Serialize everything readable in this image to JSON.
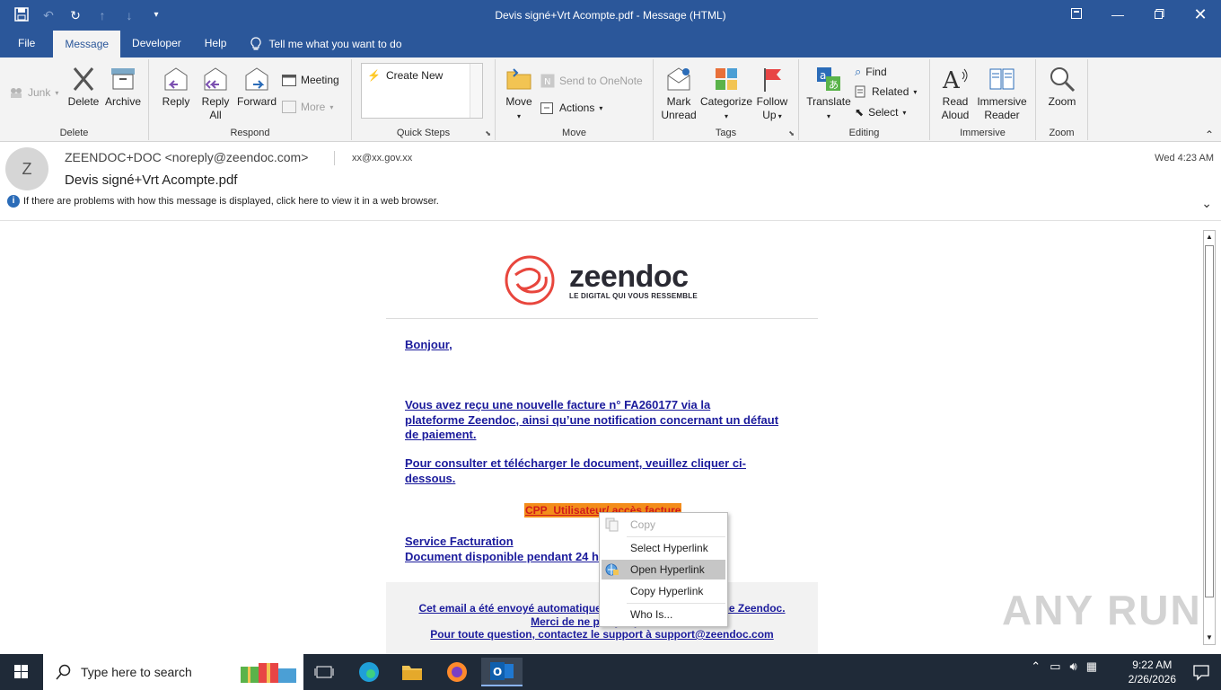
{
  "window": {
    "title": "Devis signé+Vrt Acompte.pdf  -  Message (HTML)"
  },
  "tabs": [
    {
      "label": "File"
    },
    {
      "label": "Message"
    },
    {
      "label": "Developer"
    },
    {
      "label": "Help"
    }
  ],
  "tell_me": "Tell me what you want to do",
  "ribbon": {
    "delete_group": {
      "junk": "Junk",
      "delete": "Delete",
      "archive": "Archive",
      "label": "Delete"
    },
    "respond_group": {
      "reply": "Reply",
      "reply_all_1": "Reply",
      "reply_all_2": "All",
      "forward": "Forward",
      "meeting": "Meeting",
      "more": "More",
      "label": "Respond"
    },
    "quicksteps_group": {
      "create_new": "Create New",
      "label": "Quick Steps"
    },
    "move_group": {
      "move": "Move",
      "send_onenote": "Send to OneNote",
      "actions": "Actions",
      "label": "Move"
    },
    "tags_group": {
      "mark_unread_1": "Mark",
      "mark_unread_2": "Unread",
      "categorize": "Categorize",
      "follow_up_1": "Follow",
      "follow_up_2": "Up",
      "label": "Tags"
    },
    "editing_group": {
      "translate": "Translate",
      "find": "Find",
      "related": "Related",
      "select": "Select",
      "label": "Editing"
    },
    "immersive_group": {
      "read_aloud_1": "Read",
      "read_aloud_2": "Aloud",
      "immersive_reader_1": "Immersive",
      "immersive_reader_2": "Reader",
      "label": "Immersive"
    },
    "zoom_group": {
      "zoom": "Zoom",
      "label": "Zoom"
    }
  },
  "message": {
    "avatar_letter": "Z",
    "sender": "ZEENDOC+DOC <noreply@zeendoc.com>",
    "recipient": "xx@xx.gov.xx",
    "subject": "Devis signé+Vrt Acompte.pdf",
    "date": "Wed 4:23 AM",
    "info_bar": "If there are problems with how this message is displayed, click here to view it in a web browser."
  },
  "email_body": {
    "logo_word": "zeendoc",
    "logo_tagline": "LE DIGITAL QUI VOUS RESSEMBLE",
    "greeting": "Bonjour,",
    "para1_l1": "Vous avez reçu une nouvelle facture n° FA260177 via la",
    "para1_l2": "plateforme Zeendoc, ainsi qu’une notification concernant un défaut",
    "para1_l3": "de paiement.",
    "para2_l1": "Pour consulter et télécharger le document, veuillez cliquer ci-",
    "para2_l2": "dessous.",
    "cta": "CPP_Utilisateur/ accès facture",
    "sig1": "Service Facturation",
    "sig2": "Document disponible pendant 24 h",
    "footer1": "Cet email a été envoyé automatiquement depuis la plateforme Zeendoc.",
    "footer2": "Merci de ne pas y répondre.",
    "footer3": "Pour toute question, contactez le support à support@zeendoc.com"
  },
  "context_menu": {
    "copy": "Copy",
    "select_hyperlink": "Select Hyperlink",
    "open_hyperlink": "Open Hyperlink",
    "copy_hyperlink": "Copy Hyperlink",
    "who_is": "Who Is..."
  },
  "watermark": "ANY RUN",
  "taskbar": {
    "search_placeholder": "Type here to search",
    "time": "9:22 AM",
    "date": "2/26/2026"
  },
  "colors": {
    "accent": "#2b579a",
    "link": "#1b1b9c",
    "cta_bg": "#f38d1b",
    "cta_text": "#d01a1a",
    "logo_red": "#e8463d"
  }
}
